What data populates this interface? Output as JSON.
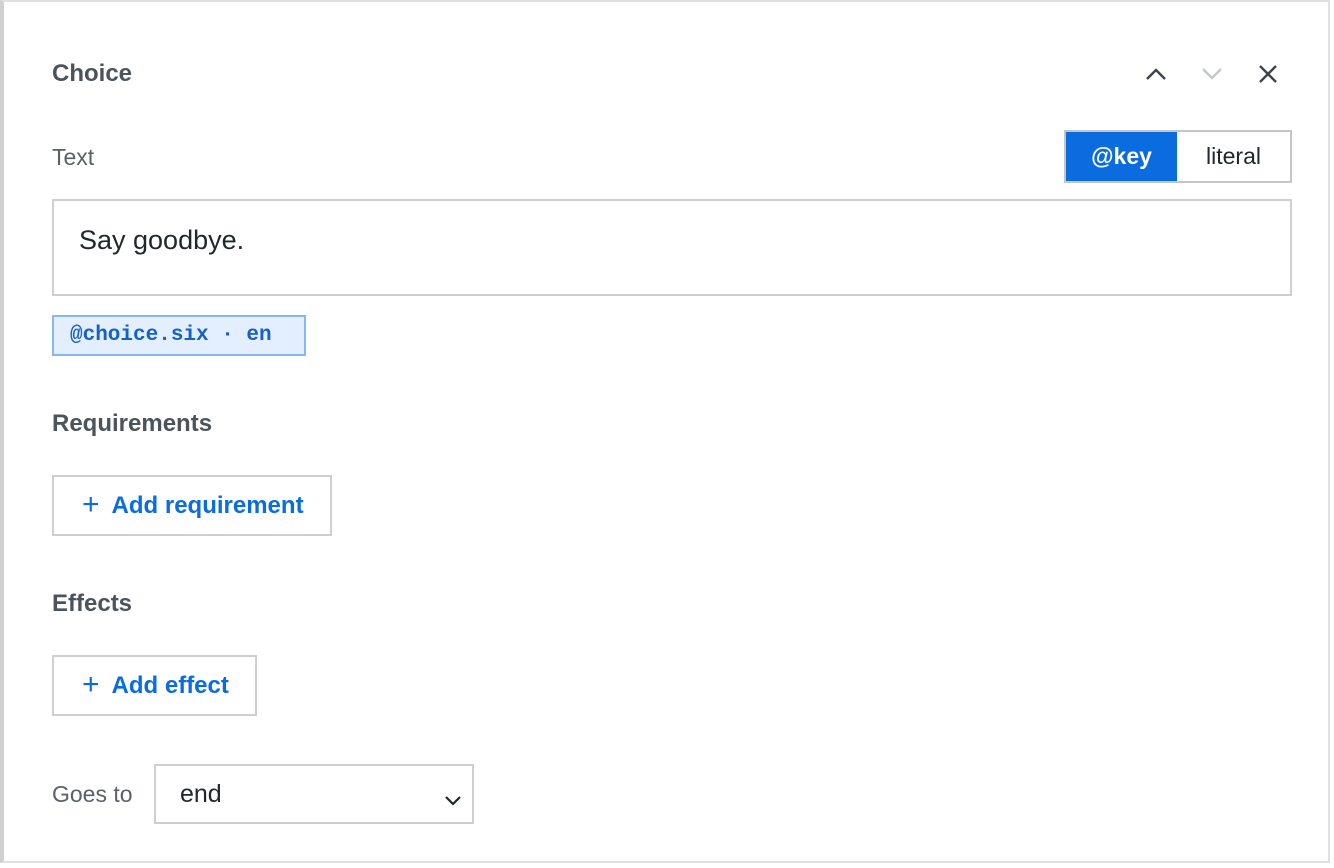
{
  "panel": {
    "title": "Choice",
    "controls": {
      "move_up_icon": "chevron-up-icon",
      "move_down_icon": "chevron-down-icon",
      "close_icon": "close-icon"
    }
  },
  "text": {
    "label": "Text",
    "mode_toggle": {
      "options": [
        "@key",
        "literal"
      ],
      "selected": "@key"
    },
    "value": "Say goodbye.",
    "key_chip": "@choice.six · en"
  },
  "requirements": {
    "heading": "Requirements",
    "add_label": "Add requirement"
  },
  "effects": {
    "heading": "Effects",
    "add_label": "Add effect"
  },
  "goes_to": {
    "label": "Goes to",
    "selected": "end"
  },
  "colors": {
    "accent": "#0b6cdf",
    "chip_bg": "#e3efff",
    "chip_border": "#89b8f0",
    "heading": "#4b535b",
    "border": "#cfcfcf"
  }
}
